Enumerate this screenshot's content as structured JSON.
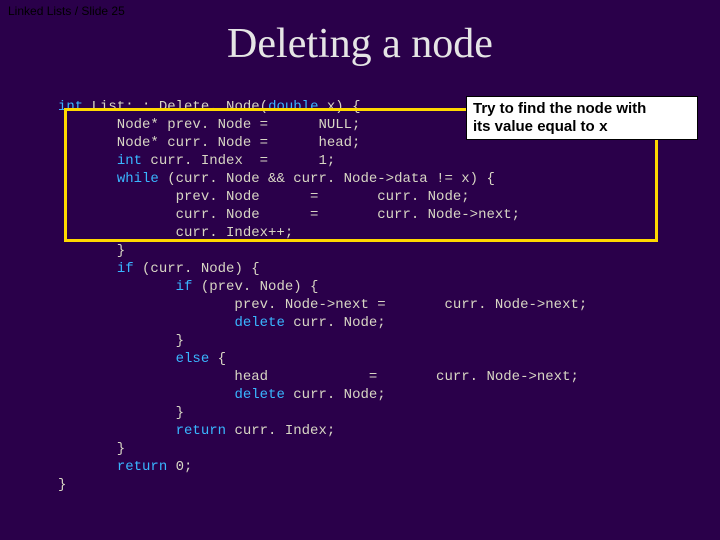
{
  "header": "Linked Lists / Slide 25",
  "title": "Deleting a node",
  "callout": {
    "line1": "Try to find the node with",
    "line2_a": "its value equal to ",
    "line2_b": "x"
  },
  "code": {
    "kw_int": "int",
    "sig_a": " List: : Delete. Node(",
    "kw_double": "double",
    "sig_b": " x) {",
    "l2": "       Node* prev. Node =      NULL;",
    "l3": "       Node* curr. Node =      head;",
    "l4a": "       ",
    "kw_int2": "int",
    "l4b": " curr. Index  =      1;",
    "l5a": "       ",
    "kw_while": "while",
    "l5b": " (curr. Node && curr. Node->data != x) {",
    "l6": "              prev. Node      =       curr. Node;",
    "l7": "              curr. Node      =       curr. Node->next;",
    "l8": "              curr. Index++;",
    "l9": "       }",
    "l10a": "       ",
    "kw_if": "if",
    "l10b": " (curr. Node) {",
    "l11a": "              ",
    "kw_if2": "if",
    "l11b": " (prev. Node) {",
    "l12": "                     prev. Node->next =       curr. Node->next;",
    "l13a": "                     ",
    "kw_delete1": "delete",
    "l13b": " curr. Node;",
    "l14": "              }",
    "l15a": "              ",
    "kw_else": "else",
    "l15b": " {",
    "l16": "                     head            =       curr. Node->next;",
    "l17a": "                     ",
    "kw_delete2": "delete",
    "l17b": " curr. Node;",
    "l18": "              }",
    "l19a": "              ",
    "kw_return1": "return",
    "l19b": " curr. Index;",
    "l20": "       }",
    "l21a": "       ",
    "kw_return2": "return",
    "l21b": " 0;",
    "l22": "}"
  }
}
